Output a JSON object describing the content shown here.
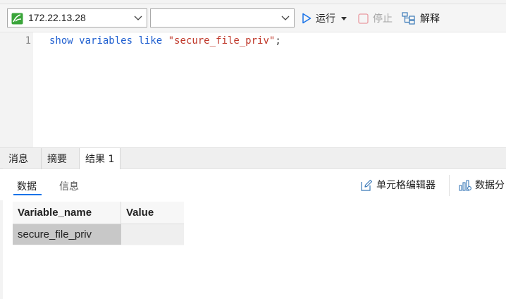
{
  "toolbar": {
    "connection": "172.22.13.28",
    "database": "",
    "run_label": "运行",
    "stop_label": "停止",
    "explain_label": "解释"
  },
  "editor": {
    "line_number": "1",
    "tokens": {
      "kw1": "show",
      "kw2": "variables",
      "kw3": "like",
      "str": "\"secure_file_priv\"",
      "end": ";"
    }
  },
  "result_tabs": [
    "消息",
    "摘要",
    "结果 1"
  ],
  "sub_tabs": [
    "数据",
    "信息"
  ],
  "sub_buttons": {
    "cell_editor": "单元格编辑器",
    "data_gen": "数据分"
  },
  "grid": {
    "columns": [
      "Variable_name",
      "Value"
    ],
    "rows": [
      [
        "secure_file_priv",
        ""
      ]
    ]
  },
  "colors": {
    "accent": "#1a73e8",
    "keyword": "#1f5fd0",
    "string": "#c0392b",
    "connection_icon": "#3aa53a"
  }
}
